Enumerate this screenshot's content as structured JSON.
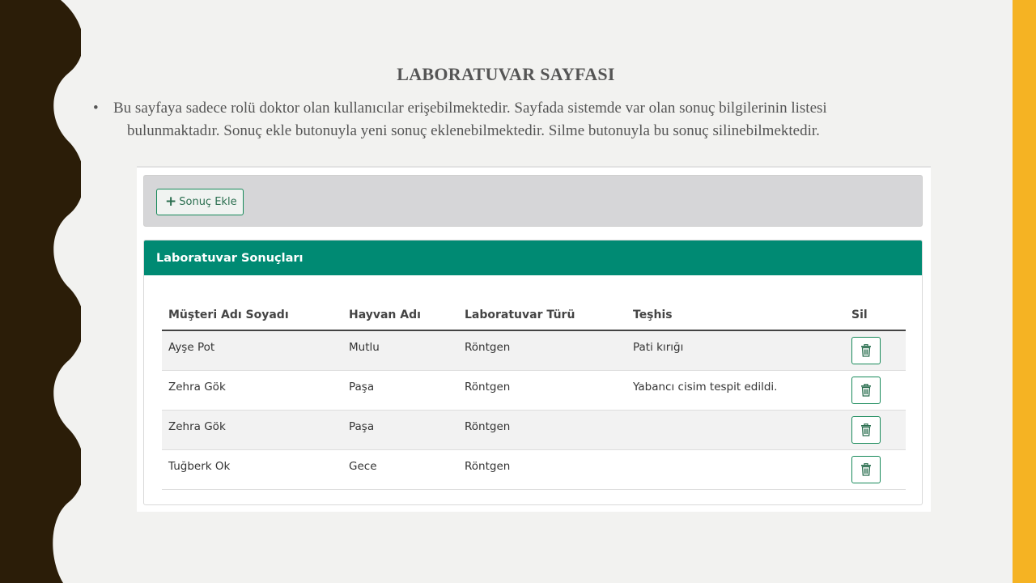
{
  "slide": {
    "title": "LABORATUVAR SAYFASI",
    "bullet_line1": "Bu sayfaya sadece rolü doktor olan kullanıcılar erişebilmektedir. Sayfada sistemde var olan sonuç bilgilerinin listesi",
    "bullet_line2": "bulunmaktadır. Sonuç ekle butonuyla yeni sonuç eklenebilmektedir. Silme butonuyla bu sonuç silinebilmektedir.",
    "accent_color": "#f5b323",
    "left_wave_color": "#2b1d08"
  },
  "toolbar": {
    "add_label": "Sonuç Ekle",
    "add_icon": "plus-icon"
  },
  "panel": {
    "title": "Laboratuvar Sonuçları",
    "header_color": "#008a73"
  },
  "table": {
    "headers": [
      "Müşteri Adı Soyadı",
      "Hayvan Adı",
      "Laboratuvar Türü",
      "Teşhis",
      "Sil"
    ],
    "rows": [
      [
        "Ayşe Pot",
        "Mutlu",
        "Röntgen",
        "Pati kırığı"
      ],
      [
        "Zehra Gök",
        "Paşa",
        "Röntgen",
        "Yabancı cisim tespit edildi."
      ],
      [
        "Zehra Gök",
        "Paşa",
        "Röntgen",
        ""
      ],
      [
        "Tuğberk Ok",
        "Gece",
        "Röntgen",
        ""
      ]
    ],
    "delete_icon": "trash-icon"
  }
}
